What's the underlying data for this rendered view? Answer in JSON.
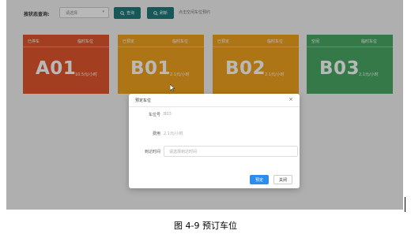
{
  "toolbar": {
    "filter_label": "按状态查询:",
    "select_value": "请选择",
    "query_button": "查询",
    "refresh_button": "刷新",
    "hint": "点击空闲车位预约"
  },
  "cards": [
    {
      "status": "已停车",
      "type": "临时车位",
      "code": "A01",
      "price": "10.5元/小时",
      "color": "#e4572e"
    },
    {
      "status": "已预定",
      "type": "临时车位",
      "code": "B01",
      "price": "2.1元/小时",
      "color": "#f0a21e"
    },
    {
      "status": "已预定",
      "type": "临时车位",
      "code": "B02",
      "price": "2.1元/小时",
      "color": "#f0a21e"
    },
    {
      "status": "空闲",
      "type": "临时车位",
      "code": "B03",
      "price": "2.1元/小时",
      "color": "#4aa866"
    }
  ],
  "modal": {
    "title": "预定车位",
    "close": "×",
    "fields": [
      {
        "label": "车位号",
        "value": "B03"
      },
      {
        "label": "费用",
        "value": "2.1元/小时"
      },
      {
        "label": "到达时间",
        "placeholder": "请选择到达时间"
      }
    ],
    "confirm_button": "预定",
    "cancel_button": "关闭"
  },
  "caption": "图 4-9  预订车位",
  "icons": {
    "query": "search-icon",
    "refresh": "search-icon",
    "cursor": "mouse-pointer-icon"
  }
}
